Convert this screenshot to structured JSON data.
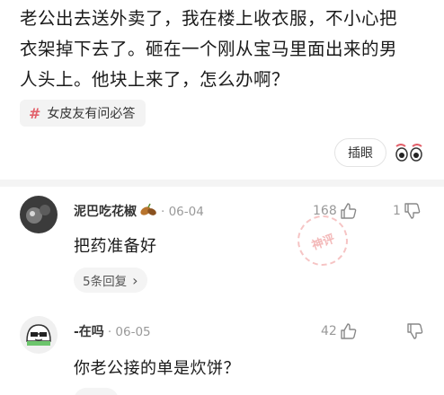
{
  "post": {
    "text_lines": [
      "老公出去送外卖了，我在楼上收衣服，不小心把",
      "衣架掉下去了。砸在一个刚从宝马里面出来的男",
      "人头上。他块上来了，怎么办啊？"
    ],
    "topic_tag": "女皮友有问必答",
    "topic_hash": "#",
    "action_label": "插眼"
  },
  "comments": [
    {
      "username": "泥巴吃花椒",
      "date": "· 06-04",
      "likes": "168",
      "dislikes": "1",
      "body": "把药准备好",
      "reply_label": "5条回复",
      "reply_chevron": "›",
      "stamp_text": "神评"
    },
    {
      "username": "-在吗",
      "date": "· 06-05",
      "likes": "42",
      "dislikes": "",
      "body": "你老公接的单是炊饼？"
    }
  ],
  "colors": {
    "accent_red": "#e2606a",
    "muted_gray": "#999999",
    "divider": "#f4f4f4"
  }
}
